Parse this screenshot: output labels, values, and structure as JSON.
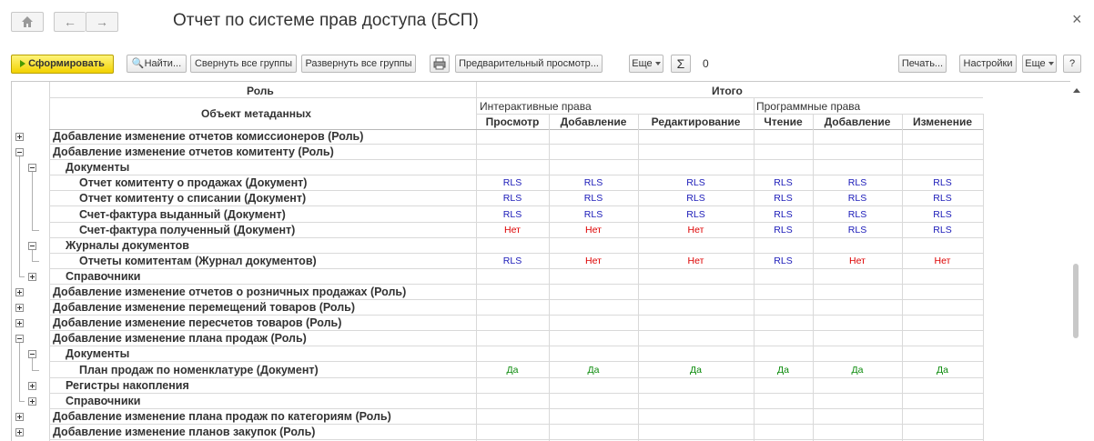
{
  "window": {
    "title": "Отчет по системе прав доступа (БСП)",
    "close_glyph": "×"
  },
  "toolbar": {
    "form": "Сформировать",
    "find": "Найти...",
    "collapse": "Свернуть все группы",
    "expand": "Развернуть все группы",
    "preview": "Предварительный просмотр...",
    "more1": "Еще",
    "sigma": "Σ",
    "sum_value": "0",
    "print": "Печать...",
    "settings": "Настройки",
    "more2": "Еще",
    "help": "?"
  },
  "report": {
    "header": {
      "role": "Роль",
      "object": "Объект метаданных",
      "total": "Итого",
      "interactive": "Интерактивные права",
      "program": "Программные права",
      "columns": [
        "Просмотр",
        "Добавление",
        "Редактирование",
        "Чтение",
        "Добавление",
        "Изменение"
      ]
    },
    "rows": [
      {
        "label": "Добавление изменение отчетов комиссионеров (Роль)",
        "level": 0,
        "toggle": "plus",
        "values": [
          "",
          "",
          "",
          "",
          "",
          ""
        ]
      },
      {
        "label": "Добавление изменение отчетов комитенту (Роль)",
        "level": 0,
        "toggle": "minus",
        "values": [
          "",
          "",
          "",
          "",
          "",
          ""
        ]
      },
      {
        "label": "Документы",
        "level": 1,
        "toggle": "minus",
        "values": [
          "",
          "",
          "",
          "",
          "",
          ""
        ]
      },
      {
        "label": "Отчет комитенту о продажах (Документ)",
        "level": 2,
        "toggle": "",
        "values": [
          "RLS",
          "RLS",
          "RLS",
          "RLS",
          "RLS",
          "RLS"
        ]
      },
      {
        "label": "Отчет комитенту о списании (Документ)",
        "level": 2,
        "toggle": "",
        "values": [
          "RLS",
          "RLS",
          "RLS",
          "RLS",
          "RLS",
          "RLS"
        ]
      },
      {
        "label": "Счет-фактура выданный (Документ)",
        "level": 2,
        "toggle": "",
        "values": [
          "RLS",
          "RLS",
          "RLS",
          "RLS",
          "RLS",
          "RLS"
        ]
      },
      {
        "label": "Счет-фактура полученный (Документ)",
        "level": 2,
        "toggle": "",
        "values": [
          "Нет",
          "Нет",
          "Нет",
          "RLS",
          "RLS",
          "RLS"
        ]
      },
      {
        "label": "Журналы документов",
        "level": 1,
        "toggle": "minus",
        "values": [
          "",
          "",
          "",
          "",
          "",
          ""
        ]
      },
      {
        "label": "Отчеты комитентам (Журнал документов)",
        "level": 2,
        "toggle": "",
        "values": [
          "RLS",
          "Нет",
          "Нет",
          "RLS",
          "Нет",
          "Нет"
        ]
      },
      {
        "label": "Справочники",
        "level": 1,
        "toggle": "plus",
        "values": [
          "",
          "",
          "",
          "",
          "",
          ""
        ]
      },
      {
        "label": "Добавление изменение отчетов о розничных продажах (Роль)",
        "level": 0,
        "toggle": "plus",
        "values": [
          "",
          "",
          "",
          "",
          "",
          ""
        ]
      },
      {
        "label": "Добавление изменение перемещений товаров (Роль)",
        "level": 0,
        "toggle": "plus",
        "values": [
          "",
          "",
          "",
          "",
          "",
          ""
        ]
      },
      {
        "label": "Добавление изменение пересчетов товаров (Роль)",
        "level": 0,
        "toggle": "plus",
        "values": [
          "",
          "",
          "",
          "",
          "",
          ""
        ]
      },
      {
        "label": "Добавление изменение плана продаж (Роль)",
        "level": 0,
        "toggle": "minus",
        "values": [
          "",
          "",
          "",
          "",
          "",
          ""
        ]
      },
      {
        "label": "Документы",
        "level": 1,
        "toggle": "minus",
        "values": [
          "",
          "",
          "",
          "",
          "",
          ""
        ]
      },
      {
        "label": "План продаж по номенклатуре (Документ)",
        "level": 2,
        "toggle": "",
        "values": [
          "Да",
          "Да",
          "Да",
          "Да",
          "Да",
          "Да"
        ]
      },
      {
        "label": "Регистры накопления",
        "level": 1,
        "toggle": "plus",
        "values": [
          "",
          "",
          "",
          "",
          "",
          ""
        ]
      },
      {
        "label": "Справочники",
        "level": 1,
        "toggle": "plus",
        "values": [
          "",
          "",
          "",
          "",
          "",
          ""
        ]
      },
      {
        "label": "Добавление изменение плана продаж по категориям (Роль)",
        "level": 0,
        "toggle": "plus",
        "values": [
          "",
          "",
          "",
          "",
          "",
          ""
        ]
      },
      {
        "label": "Добавление изменение планов закупок (Роль)",
        "level": 0,
        "toggle": "plus",
        "values": [
          "",
          "",
          "",
          "",
          "",
          ""
        ]
      }
    ]
  }
}
